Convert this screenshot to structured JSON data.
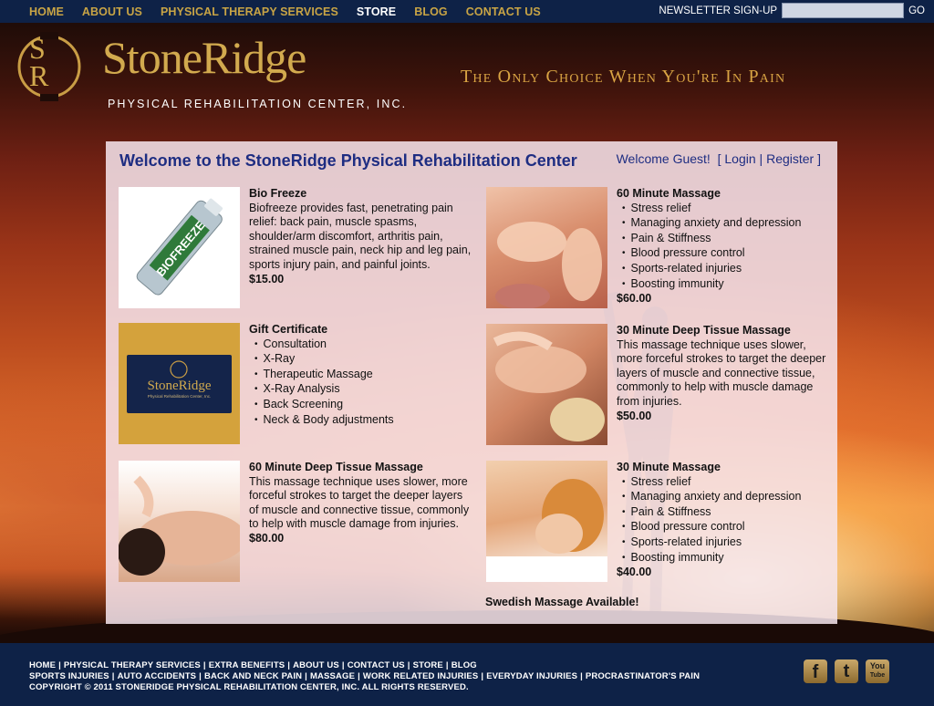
{
  "nav": {
    "items": [
      "HOME",
      "ABOUT US",
      "PHYSICAL THERAPY SERVICES",
      "STORE",
      "BLOG",
      "CONTACT US"
    ],
    "active": "STORE",
    "newsletter_label": "NEWSLETTER SIGN-UP",
    "newsletter_placeholder": "",
    "go_label": "GO"
  },
  "header": {
    "monogram": "SR",
    "brand": "StoneRidge",
    "subtitle": "PHYSICAL REHABILITATION CENTER, INC.",
    "tagline": "The Only Choice When You're In Pain"
  },
  "main": {
    "welcome_title": "Welcome to the StoneRidge Physical Rehabilitation Center",
    "greeting": "Welcome Guest!",
    "bracket_open": "[",
    "login": "Login",
    "divider": "|",
    "register": "Register",
    "bracket_close": "]",
    "products": [
      {
        "title": "Bio Freeze",
        "description": "Biofreeze provides fast, penetrating pain relief: back pain, muscle spasms, shoulder/arm discomfort, arthritis pain, strained muscle pain, neck hip and leg pain, sports injury pain, and painful joints.",
        "bullets": [],
        "price": "$15.00",
        "image": "biofreeze-tube",
        "image_text": "BIOFREEZE"
      },
      {
        "title": "60 Minute Massage",
        "description": "",
        "bullets": [
          "Stress relief",
          "Managing anxiety and depression",
          "Pain & Stiffness",
          "Blood pressure control",
          "Sports-related injuries",
          "Boosting immunity"
        ],
        "price": "$60.00",
        "image": "shoulder-massage"
      },
      {
        "title": "Gift Certificate",
        "description": "",
        "bullets": [
          "Consultation",
          "X-Ray",
          "Therapeutic Massage",
          "X-Ray Analysis",
          "Back Screening",
          "Neck & Body adjustments"
        ],
        "price": "",
        "image": "stoneridge-gift-card",
        "image_text": "StoneRidge",
        "image_subtext": "Physical Rehabilitation Center, Inc."
      },
      {
        "title": "30 Minute Deep Tissue Massage",
        "description": "This massage technique uses slower, more forceful strokes to target the deeper layers of muscle and connective tissue, commonly to help with muscle damage from injuries.",
        "bullets": [],
        "price": "$50.00",
        "image": "deep-tissue-massage"
      },
      {
        "title": "60 Minute Deep Tissue Massage",
        "description": "This massage technique uses slower, more forceful strokes to target the deeper layers of muscle and connective tissue, commonly to help with muscle damage from injuries.",
        "bullets": [],
        "price": "$80.00",
        "image": "back-massage"
      },
      {
        "title": "30 Minute Massage",
        "description": "",
        "bullets": [
          "Stress relief",
          "Managing anxiety and depression",
          "Pain & Stiffness",
          "Blood pressure control",
          "Sports-related injuries",
          "Boosting immunity"
        ],
        "price": "$40.00",
        "image": "relaxing-massage"
      }
    ],
    "swedish_note": "Swedish Massage Available!"
  },
  "footer": {
    "row1": [
      "HOME",
      "PHYSICAL THERAPY SERVICES",
      "EXTRA BENEFITS",
      "ABOUT US",
      "CONTACT US",
      "STORE",
      "BLOG"
    ],
    "row2": [
      "SPORTS INJURIES",
      "AUTO ACCIDENTS",
      "BACK AND NECK PAIN",
      "MASSAGE",
      "WORK RELATED INJURIES",
      "EVERYDAY INJURIES",
      "PROCRASTINATOR'S PAIN"
    ],
    "copyright": "COPYRIGHT © 2011 STONERIDGE PHYSICAL REHABILITATION CENTER, INC. ALL RIGHTS RESERVED.",
    "separator": "|",
    "social": [
      {
        "name": "facebook-icon",
        "glyph": "f"
      },
      {
        "name": "twitter-icon",
        "glyph": "t"
      },
      {
        "name": "youtube-icon",
        "glyph": "You",
        "glyph2": "Tube"
      }
    ]
  },
  "colors": {
    "nav_bg": "#0e2247",
    "nav_link": "#c8a445",
    "brand_gold": "#d2aa4e",
    "title_blue": "#1e2d82"
  }
}
